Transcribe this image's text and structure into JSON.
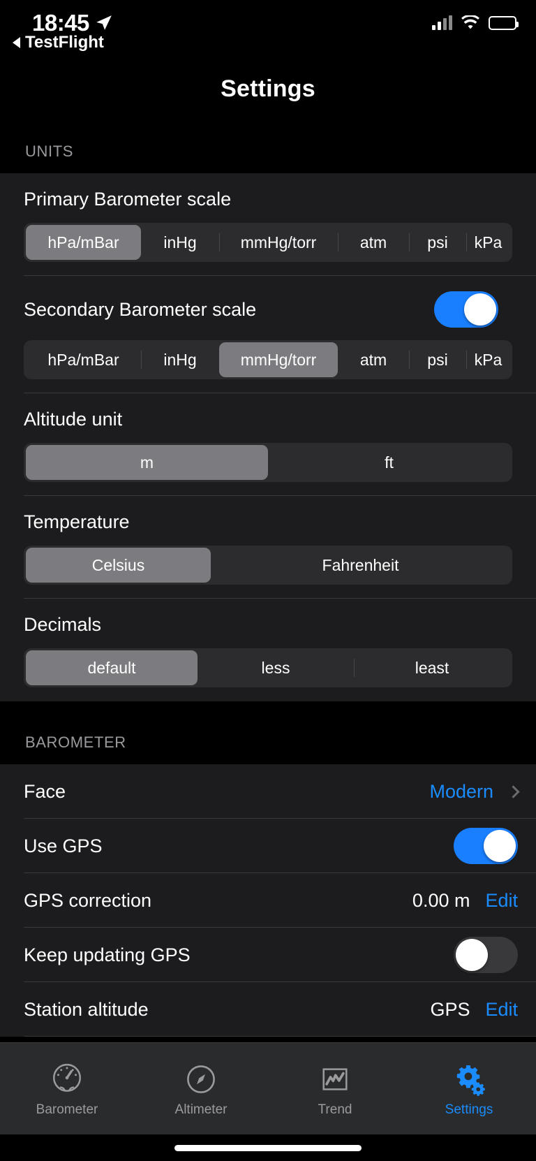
{
  "status_bar": {
    "time": "18:45",
    "back_app": "TestFlight",
    "location_icon": "location-arrow-icon",
    "signal_icon": "cellular-signal-icon",
    "wifi_icon": "wifi-icon",
    "battery_icon": "battery-icon"
  },
  "nav": {
    "title": "Settings"
  },
  "sections": {
    "units": {
      "header": "UNITS",
      "primary_barometer": {
        "label": "Primary Barometer scale",
        "options": [
          "hPa/mBar",
          "inHg",
          "mmHg/torr",
          "atm",
          "psi",
          "kPa"
        ],
        "selected": "hPa/mBar"
      },
      "secondary_barometer": {
        "label": "Secondary Barometer scale",
        "enabled": true,
        "options": [
          "hPa/mBar",
          "inHg",
          "mmHg/torr",
          "atm",
          "psi",
          "kPa"
        ],
        "selected": "mmHg/torr"
      },
      "altitude_unit": {
        "label": "Altitude unit",
        "options": [
          "m",
          "ft"
        ],
        "selected": "m"
      },
      "temperature": {
        "label": "Temperature",
        "options": [
          "Celsius",
          "Fahrenheit"
        ],
        "selected": "Celsius"
      },
      "decimals": {
        "label": "Decimals",
        "options": [
          "default",
          "less",
          "least"
        ],
        "selected": "default"
      }
    },
    "barometer": {
      "header": "BAROMETER",
      "rows": [
        {
          "label": "Face",
          "value": "Modern",
          "type": "disclosure"
        },
        {
          "label": "Use GPS",
          "value": "",
          "type": "toggle",
          "enabled": true
        },
        {
          "label": "GPS correction",
          "value": "0.00 m",
          "action": "Edit",
          "type": "value-edit"
        },
        {
          "label": "Keep updating GPS",
          "value": "",
          "type": "toggle",
          "enabled": false
        },
        {
          "label": "Station altitude",
          "value": "GPS",
          "action": "Edit",
          "type": "value-edit"
        }
      ]
    }
  },
  "tabbar": {
    "tabs": [
      {
        "label": "Barometer",
        "icon": "gauge-icon",
        "active": false
      },
      {
        "label": "Altimeter",
        "icon": "compass-icon",
        "active": false
      },
      {
        "label": "Trend",
        "icon": "chart-trend-icon",
        "active": false
      },
      {
        "label": "Settings",
        "icon": "gears-icon",
        "active": true
      }
    ]
  },
  "colors": {
    "accent_blue": "#1a8cff",
    "toggle_on": "#1a7fff",
    "segment_selected": "#7c7c80",
    "group_bg": "#1c1c1e"
  }
}
